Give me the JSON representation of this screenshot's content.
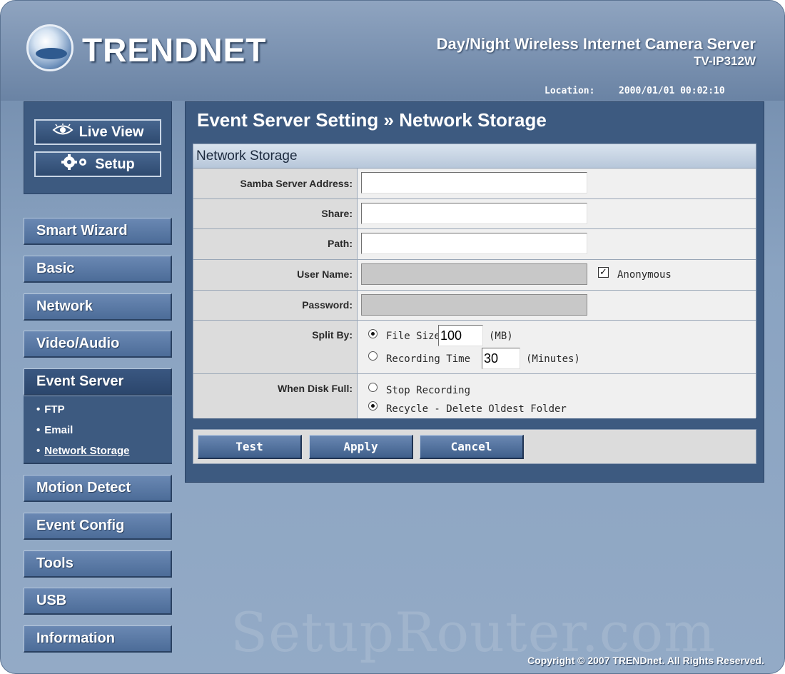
{
  "header": {
    "logo_text": "TRENDNET",
    "product_name": "Day/Night Wireless Internet Camera Server",
    "model": "TV-IP312W",
    "location_label": "Location:",
    "location_value": "2000/01/01 00:02:10"
  },
  "view_panel": {
    "live_view_label": "Live View",
    "setup_label": "Setup"
  },
  "nav": {
    "items": [
      {
        "label": "Smart Wizard"
      },
      {
        "label": "Basic"
      },
      {
        "label": "Network"
      },
      {
        "label": "Video/Audio"
      },
      {
        "label": "Event Server"
      },
      {
        "label": "Motion Detect"
      },
      {
        "label": "Event Config"
      },
      {
        "label": "Tools"
      },
      {
        "label": "USB"
      },
      {
        "label": "Information"
      }
    ],
    "active": "Event Server",
    "sub_items": [
      {
        "label": "FTP"
      },
      {
        "label": "Email"
      },
      {
        "label": "Network Storage"
      }
    ],
    "current_sub": "Network Storage"
  },
  "content": {
    "title": "Event Server Setting » Network Storage",
    "section_header": "Network Storage",
    "fields": {
      "samba_label": "Samba Server Address:",
      "samba_value": "",
      "share_label": "Share:",
      "share_value": "",
      "path_label": "Path:",
      "path_value": "",
      "username_label": "User Name:",
      "username_value": "",
      "anonymous_label": "Anonymous",
      "anonymous_checked": true,
      "password_label": "Password:",
      "password_value": ""
    },
    "split_by": {
      "label": "Split By:",
      "file_size_label": "File Size",
      "file_size_value": "100",
      "file_size_unit": "(MB)",
      "recording_time_label": "Recording Time",
      "recording_time_value": "30",
      "recording_time_unit": "(Minutes)",
      "selected": "File Size"
    },
    "disk_full": {
      "label": "When Disk Full:",
      "stop_label": "Stop Recording",
      "recycle_label": "Recycle - Delete Oldest Folder",
      "selected": "Recycle - Delete Oldest Folder"
    },
    "buttons": {
      "test": "Test",
      "apply": "Apply",
      "cancel": "Cancel"
    }
  },
  "watermark": "SetupRouter.com",
  "copyright": "Copyright © 2007 TRENDnet. All Rights Reserved."
}
